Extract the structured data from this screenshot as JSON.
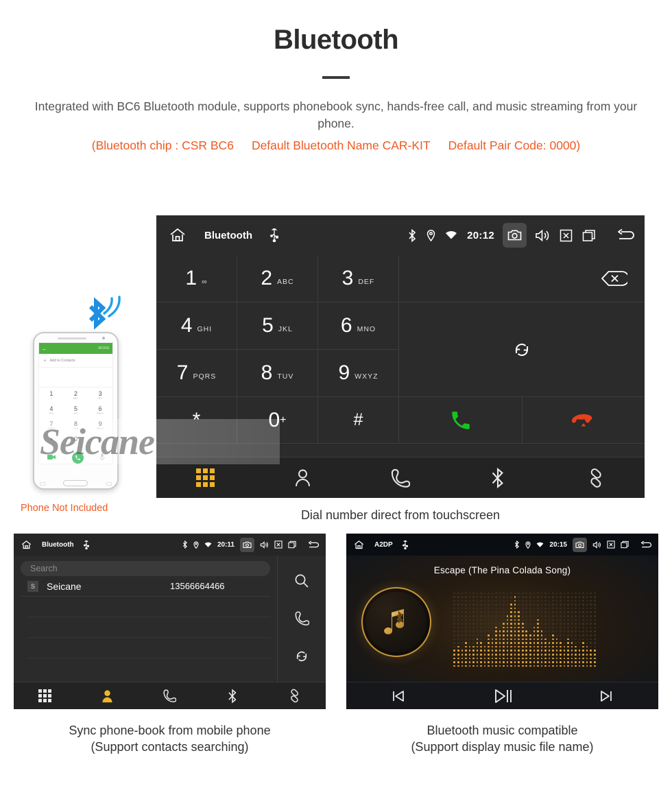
{
  "header": {
    "title": "Bluetooth",
    "paragraph": "Integrated with BC6 Bluetooth module, supports phonebook sync, hands-free call, and music streaming from your phone.",
    "chip_info": "(Bluetooth chip : CSR BC6",
    "bt_name": "Default Bluetooth Name CAR-KIT",
    "pair_code": "Default Pair Code: 0000)",
    "accent_color": "#f05a22",
    "title_color": "#2d2d2d"
  },
  "dialer": {
    "status": {
      "title": "Bluetooth",
      "time": "20:12",
      "icons": [
        "home-icon",
        "usb-icon",
        "bluetooth-icon",
        "location-icon",
        "wifi-icon",
        "camera-icon",
        "volume-icon",
        "close-box-icon",
        "recents-icon",
        "back-icon"
      ]
    },
    "keys": [
      {
        "digit": "1",
        "letters": "∞"
      },
      {
        "digit": "2",
        "letters": "ABC"
      },
      {
        "digit": "3",
        "letters": "DEF"
      },
      {
        "digit": "4",
        "letters": "GHI"
      },
      {
        "digit": "5",
        "letters": "JKL"
      },
      {
        "digit": "6",
        "letters": "MNO"
      },
      {
        "digit": "7",
        "letters": "PQRS"
      },
      {
        "digit": "8",
        "letters": "TUV"
      },
      {
        "digit": "9",
        "letters": "WXYZ"
      },
      {
        "digit": "*",
        "letters": ""
      },
      {
        "digit": "0",
        "letters": "",
        "sup": "+"
      },
      {
        "digit": "#",
        "letters": ""
      }
    ],
    "number_value": "",
    "nav": [
      "dialpad-icon",
      "contacts-icon",
      "call-log-icon",
      "bluetooth-icon",
      "pair-link-icon"
    ],
    "active_nav": "dialpad-icon",
    "active_color": "#f0b429",
    "call_color": "#19c21f",
    "hangup_color": "#e8401c"
  },
  "phone_mockup": {
    "more_label": "MORE",
    "add_contact_label": "Add to Contacts",
    "keys": [
      {
        "d": "1",
        "s": "∞"
      },
      {
        "d": "2",
        "s": "ABC"
      },
      {
        "d": "3",
        "s": "DEF"
      },
      {
        "d": "4",
        "s": "GHI"
      },
      {
        "d": "5",
        "s": "JKL"
      },
      {
        "d": "6",
        "s": "MNO"
      },
      {
        "d": "7",
        "s": "PQRS"
      },
      {
        "d": "8",
        "s": "TUV"
      },
      {
        "d": "9",
        "s": "WXYZ"
      },
      {
        "d": "*",
        "s": ""
      },
      {
        "d": "0",
        "s": "+"
      },
      {
        "d": "#",
        "s": ""
      }
    ],
    "disclaimer": "Phone Not Included"
  },
  "captions": {
    "main": "Dial number direct from touchscreen",
    "left_line1": "Sync phone-book from mobile phone",
    "left_line2": "(Support contacts searching)",
    "right_line1": "Bluetooth music compatible",
    "right_line2": "(Support display music file name)"
  },
  "phonebook": {
    "status": {
      "title": "Bluetooth",
      "time": "20:11"
    },
    "search_placeholder": "Search",
    "contacts": [
      {
        "initial": "S",
        "name": "Seicane",
        "number": "13566664466"
      }
    ],
    "side_actions": [
      "search-icon",
      "call-icon",
      "refresh-icon"
    ],
    "nav": [
      "dialpad-icon",
      "contacts-icon",
      "call-log-icon",
      "bluetooth-icon",
      "pair-link-icon"
    ],
    "active_nav": "contacts-icon"
  },
  "music": {
    "status": {
      "title": "A2DP",
      "time": "20:15"
    },
    "track_title": "Escape (The Pina Colada Song)",
    "controls": [
      "previous-icon",
      "play-pause-icon",
      "next-icon"
    ],
    "accent_color": "#e0a53c"
  },
  "watermark": {
    "text": "Seicane"
  }
}
